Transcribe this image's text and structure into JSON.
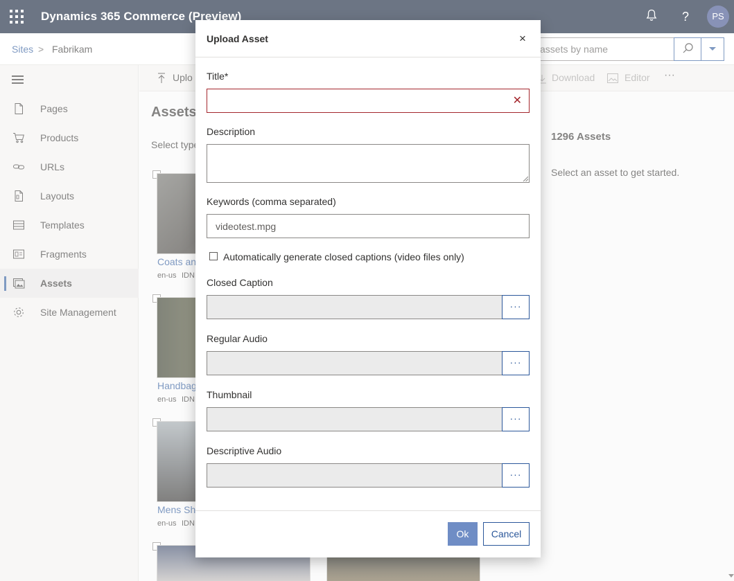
{
  "app": {
    "title": "Dynamics 365 Commerce (Preview)",
    "user_initials": "PS",
    "notification_icon": "bell-icon",
    "help_label": "?"
  },
  "breadcrumb": {
    "root": "Sites",
    "separator": ">",
    "current": "Fabrikam"
  },
  "search": {
    "placeholder": "assets by name"
  },
  "sidebar": {
    "items": [
      {
        "label": "Pages",
        "icon": "page-icon"
      },
      {
        "label": "Products",
        "icon": "cart-icon"
      },
      {
        "label": "URLs",
        "icon": "link-icon"
      },
      {
        "label": "Layouts",
        "icon": "layout-icon"
      },
      {
        "label": "Templates",
        "icon": "template-icon"
      },
      {
        "label": "Fragments",
        "icon": "fragment-icon"
      },
      {
        "label": "Assets",
        "icon": "assets-icon",
        "active": true
      },
      {
        "label": "Site Management",
        "icon": "gear-icon"
      }
    ]
  },
  "toolbar": {
    "upload_label": "Uplo",
    "download_label": "Download",
    "editor_label": "Editor",
    "more_label": "···"
  },
  "main": {
    "title": "Assets",
    "select_type_label": "Select type",
    "asset_count": "1296 Assets",
    "empty_hint": "Select an asset to get started.",
    "cards": [
      {
        "title": "Coats and",
        "locale": "en-us",
        "id_label": "IDN"
      },
      {
        "title": "Handbag",
        "locale": "en-us",
        "id_label": "IDN"
      },
      {
        "title": "Mens She",
        "locale": "en-us",
        "id_label": "IDN"
      }
    ]
  },
  "dialog": {
    "title": "Upload Asset",
    "close_label": "×",
    "fields": {
      "title_label": "Title*",
      "title_value": "",
      "description_label": "Description",
      "keywords_label": "Keywords (comma separated)",
      "keywords_value": "videotest.mpg",
      "auto_captions_label": "Automatically generate closed captions (video files only)",
      "auto_captions_checked": false,
      "closed_caption_label": "Closed Caption",
      "regular_audio_label": "Regular Audio",
      "thumbnail_label": "Thumbnail",
      "descriptive_audio_label": "Descriptive Audio",
      "browse_label": "···"
    },
    "ok_label": "Ok",
    "cancel_label": "Cancel"
  },
  "colors": {
    "topbar": "#0b1a33",
    "accent": "#2b579a",
    "error": "#a4262c",
    "ok_button": "#6f8dc5"
  }
}
